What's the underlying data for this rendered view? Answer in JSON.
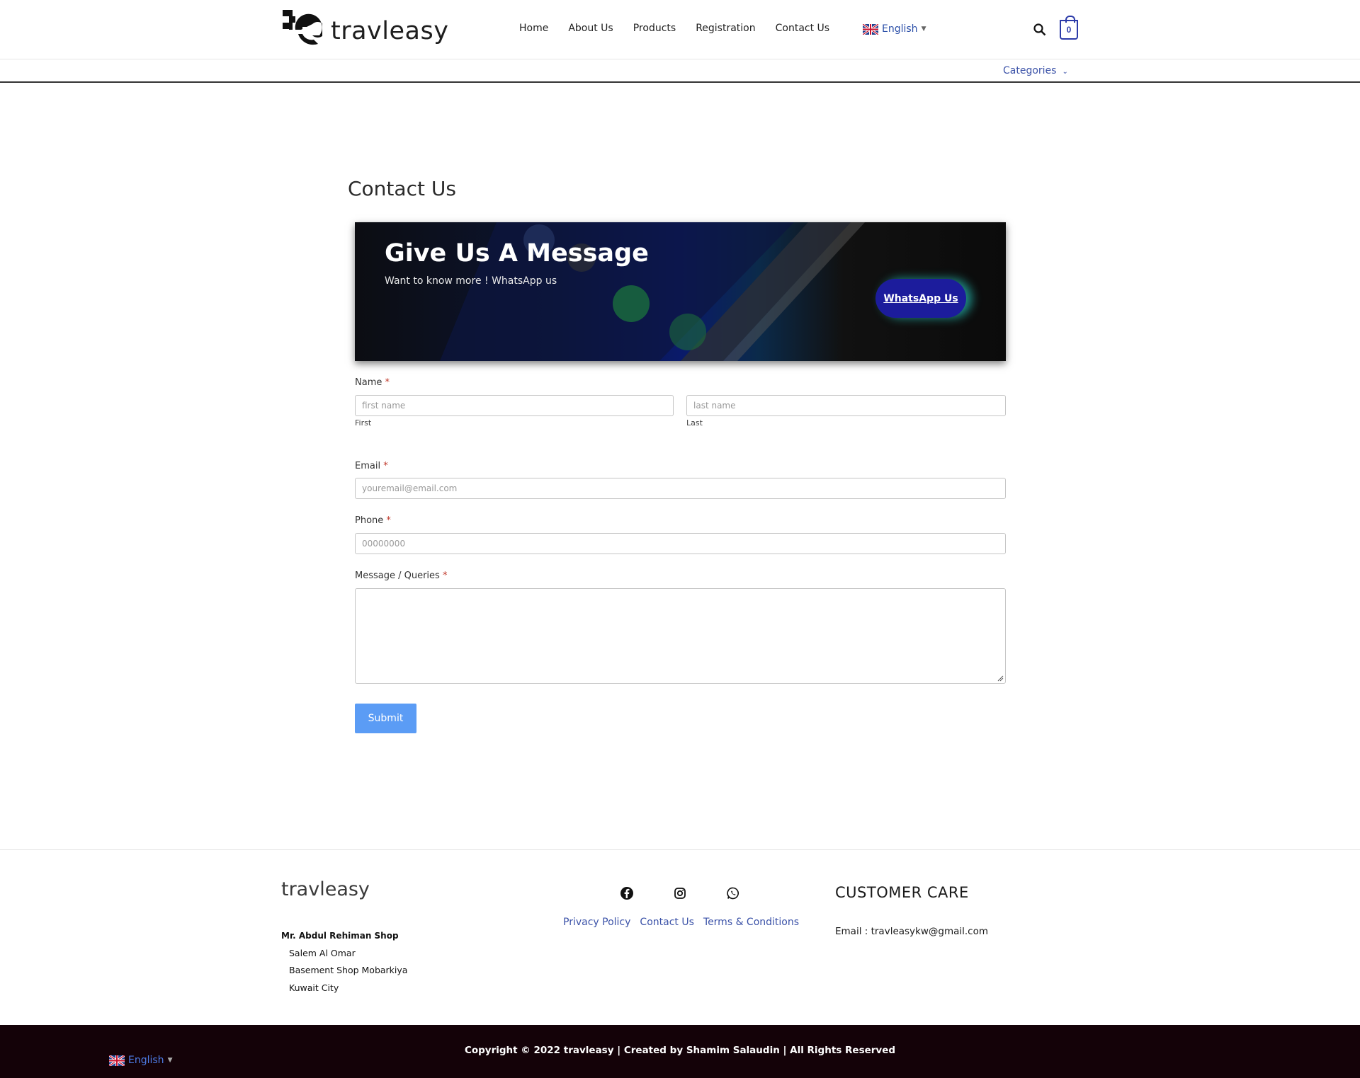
{
  "header": {
    "logo_text": "travleasy",
    "nav": [
      "Home",
      "About Us",
      "Products",
      "Registration",
      "Contact Us"
    ],
    "language": "English",
    "cart_count": "0",
    "categories": "Categories"
  },
  "main": {
    "page_title": "Contact Us",
    "banner": {
      "title": "Give Us A Message",
      "subtitle": "Want to know more ! WhatsApp us",
      "button": "WhatsApp Us"
    },
    "form": {
      "name_label": "Name",
      "required_mark": "*",
      "first_placeholder": "first name",
      "first_sublabel": "First",
      "last_placeholder": "last name",
      "last_sublabel": "Last",
      "email_label": "Email",
      "email_placeholder": "youremail@email.com",
      "phone_label": "Phone",
      "phone_placeholder": "00000000",
      "message_label": "Message / Queries",
      "submit": "Submit"
    }
  },
  "footer": {
    "logo_text": "travleasy",
    "address": {
      "name": "Mr. Abdul Rehiman Shop",
      "lines": [
        "Salem Al Omar",
        "Basement Shop Mobarkiya",
        "Kuwait City"
      ]
    },
    "social_icons": [
      "facebook-icon",
      "instagram-icon",
      "whatsapp-icon"
    ],
    "links": [
      "Privacy Policy",
      "Contact Us",
      "Terms & Conditions"
    ],
    "customer_care_title": "CUSTOMER CARE",
    "email": "Email : travleasykw@gmail.com",
    "copyright": "Copyright © 2022 travleasy | Created by Shamim Salaudin | All Rights Reserved",
    "language": "English"
  },
  "colors": {
    "accent_blue": "#3b52a8",
    "submit_blue": "#5b9cf5",
    "whatsapp_button": "#1c1c9c",
    "bottom_bar": "#140208"
  }
}
